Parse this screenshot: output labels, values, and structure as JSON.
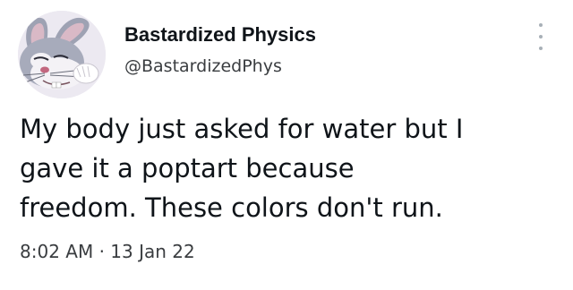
{
  "tweet": {
    "author": {
      "display_name": "Bastardized Physics",
      "handle": "@BastardizedPhys",
      "avatar_icon": "bugs-bunny-avatar-icon"
    },
    "more_icon": "more-dots-icon",
    "text_lines": [
      "My body just asked for water but I",
      "gave it a poptart because",
      "freedom. These colors don't run."
    ],
    "time": "8:02 AM",
    "separator": "·",
    "date": "13 Jan 22"
  },
  "colors": {
    "text_primary": "#0f1419",
    "text_secondary": "#3a3d40",
    "more_dots": "#a8b0b7",
    "background": "#ffffff"
  }
}
